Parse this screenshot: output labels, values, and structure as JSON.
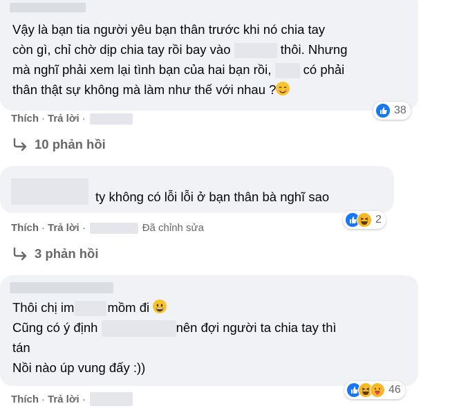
{
  "comments": [
    {
      "lines": [
        "Vậy là bạn tia người yêu bạn thân trước khi nó chia tay",
        "còn gì, chỉ chờ dịp chia tay rồi bay vào",
        "thôi. Nhưng",
        "mà nghĩ phải xem lại tình bạn của hai bạn rồi,",
        "có phải",
        "thân thật sự không mà làm như thế với nhau ?"
      ],
      "actions": {
        "like": "Thích",
        "reply": "Trả lời"
      },
      "reaction_count": "38",
      "replies": "10 phản hồi"
    },
    {
      "text": "ty không có lỗi lỗi ở bạn thân bà nghĩ sao",
      "actions": {
        "like": "Thích",
        "reply": "Trả lời",
        "edited": "Đã chỉnh sửa"
      },
      "reaction_count": "2",
      "replies": "3 phản hồi"
    },
    {
      "lines": [
        "Thôi chị im",
        "mồm đi",
        "Cũng có ý định",
        "nên đợi người ta chia tay thì",
        "tán",
        "Nồi nào úp vung đấy :))"
      ],
      "actions": {
        "like": "Thích",
        "reply": "Trả lời"
      },
      "reaction_count": "46"
    }
  ],
  "colors": {
    "bubble": "#f0f2f5",
    "muted": "#65676b",
    "like_blue": "#1877f2",
    "emoji_yellow": "#f7b928"
  }
}
